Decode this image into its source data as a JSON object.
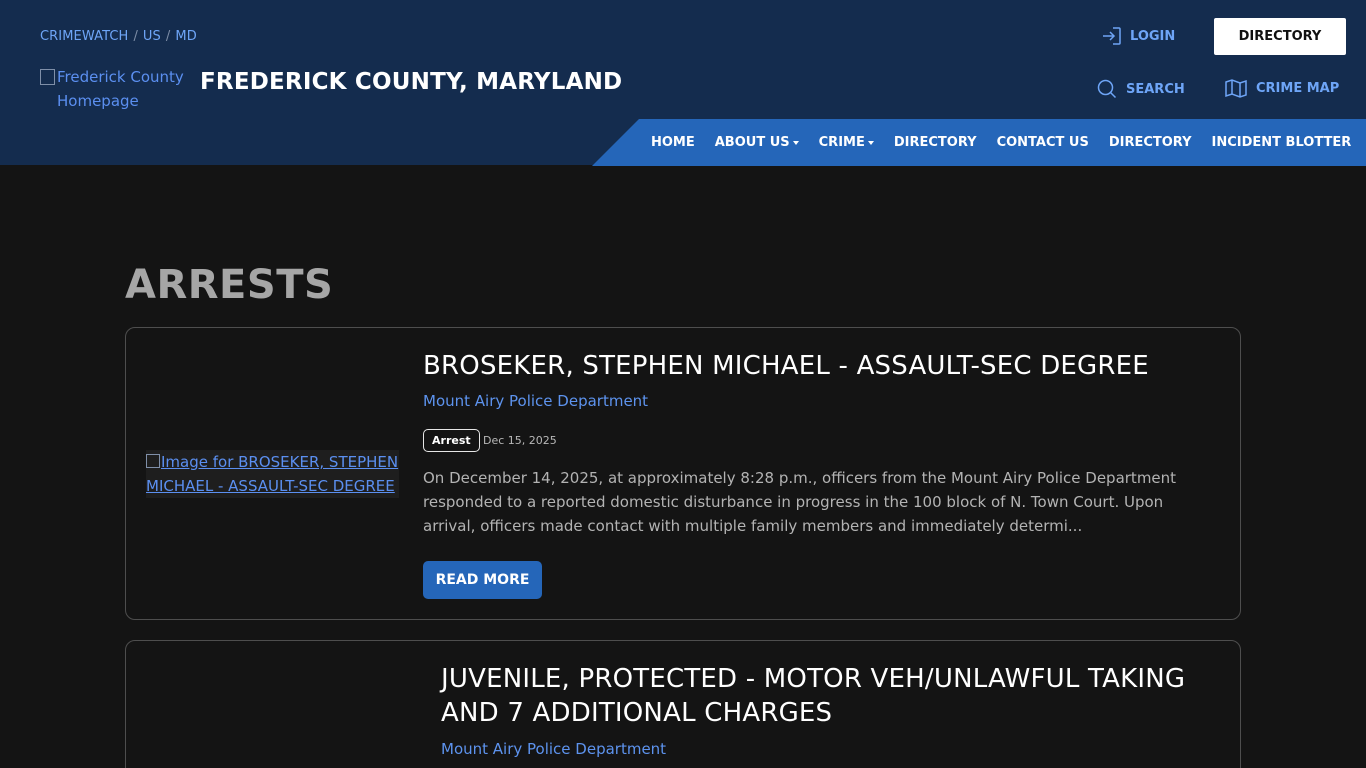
{
  "breadcrumbs": [
    "CRIMEWATCH",
    "US",
    "MD"
  ],
  "breadcrumb_sep": "/",
  "logo_alt": "Frederick County Homepage",
  "site_title": "FREDERICK COUNTY, MARYLAND",
  "header_actions": {
    "login": "LOGIN",
    "directory": "DIRECTORY",
    "search": "SEARCH",
    "crime_map": "CRIME MAP"
  },
  "nav": [
    {
      "label": "HOME",
      "dropdown": false
    },
    {
      "label": "ABOUT US",
      "dropdown": true
    },
    {
      "label": "CRIME",
      "dropdown": true
    },
    {
      "label": "DIRECTORY",
      "dropdown": false
    },
    {
      "label": "CONTACT US",
      "dropdown": false
    },
    {
      "label": "DIRECTORY",
      "dropdown": false
    },
    {
      "label": "INCIDENT BLOTTER",
      "dropdown": false
    }
  ],
  "page_heading": "ARRESTS",
  "posts": [
    {
      "image_alt": "Image for BROSEKER, STEPHEN MICHAEL - ASSAULT-SEC DEGREE",
      "title": "BROSEKER, STEPHEN MICHAEL - ASSAULT-SEC DEGREE",
      "agency": "Mount Airy Police Department",
      "badge": "Arrest",
      "date": "Dec 15, 2025",
      "excerpt": "On December 14, 2025, at approximately 8:28 p.m., officers from the Mount Airy Police Department responded to a reported domestic disturbance in progress in the 100 block of N. Town Court. Upon arrival, officers made contact with multiple family members and immediately determi...",
      "read_more": "READ MORE"
    },
    {
      "title": "JUVENILE, PROTECTED - MOTOR VEH/UNLAWFUL TAKING AND 7 ADDITIONAL CHARGES",
      "agency": "Mount Airy Police Department"
    }
  ],
  "colors": {
    "header_bg": "#142c4e",
    "nav_bg": "#2566b9",
    "link": "#6ea5f7",
    "page_bg": "#141414"
  }
}
